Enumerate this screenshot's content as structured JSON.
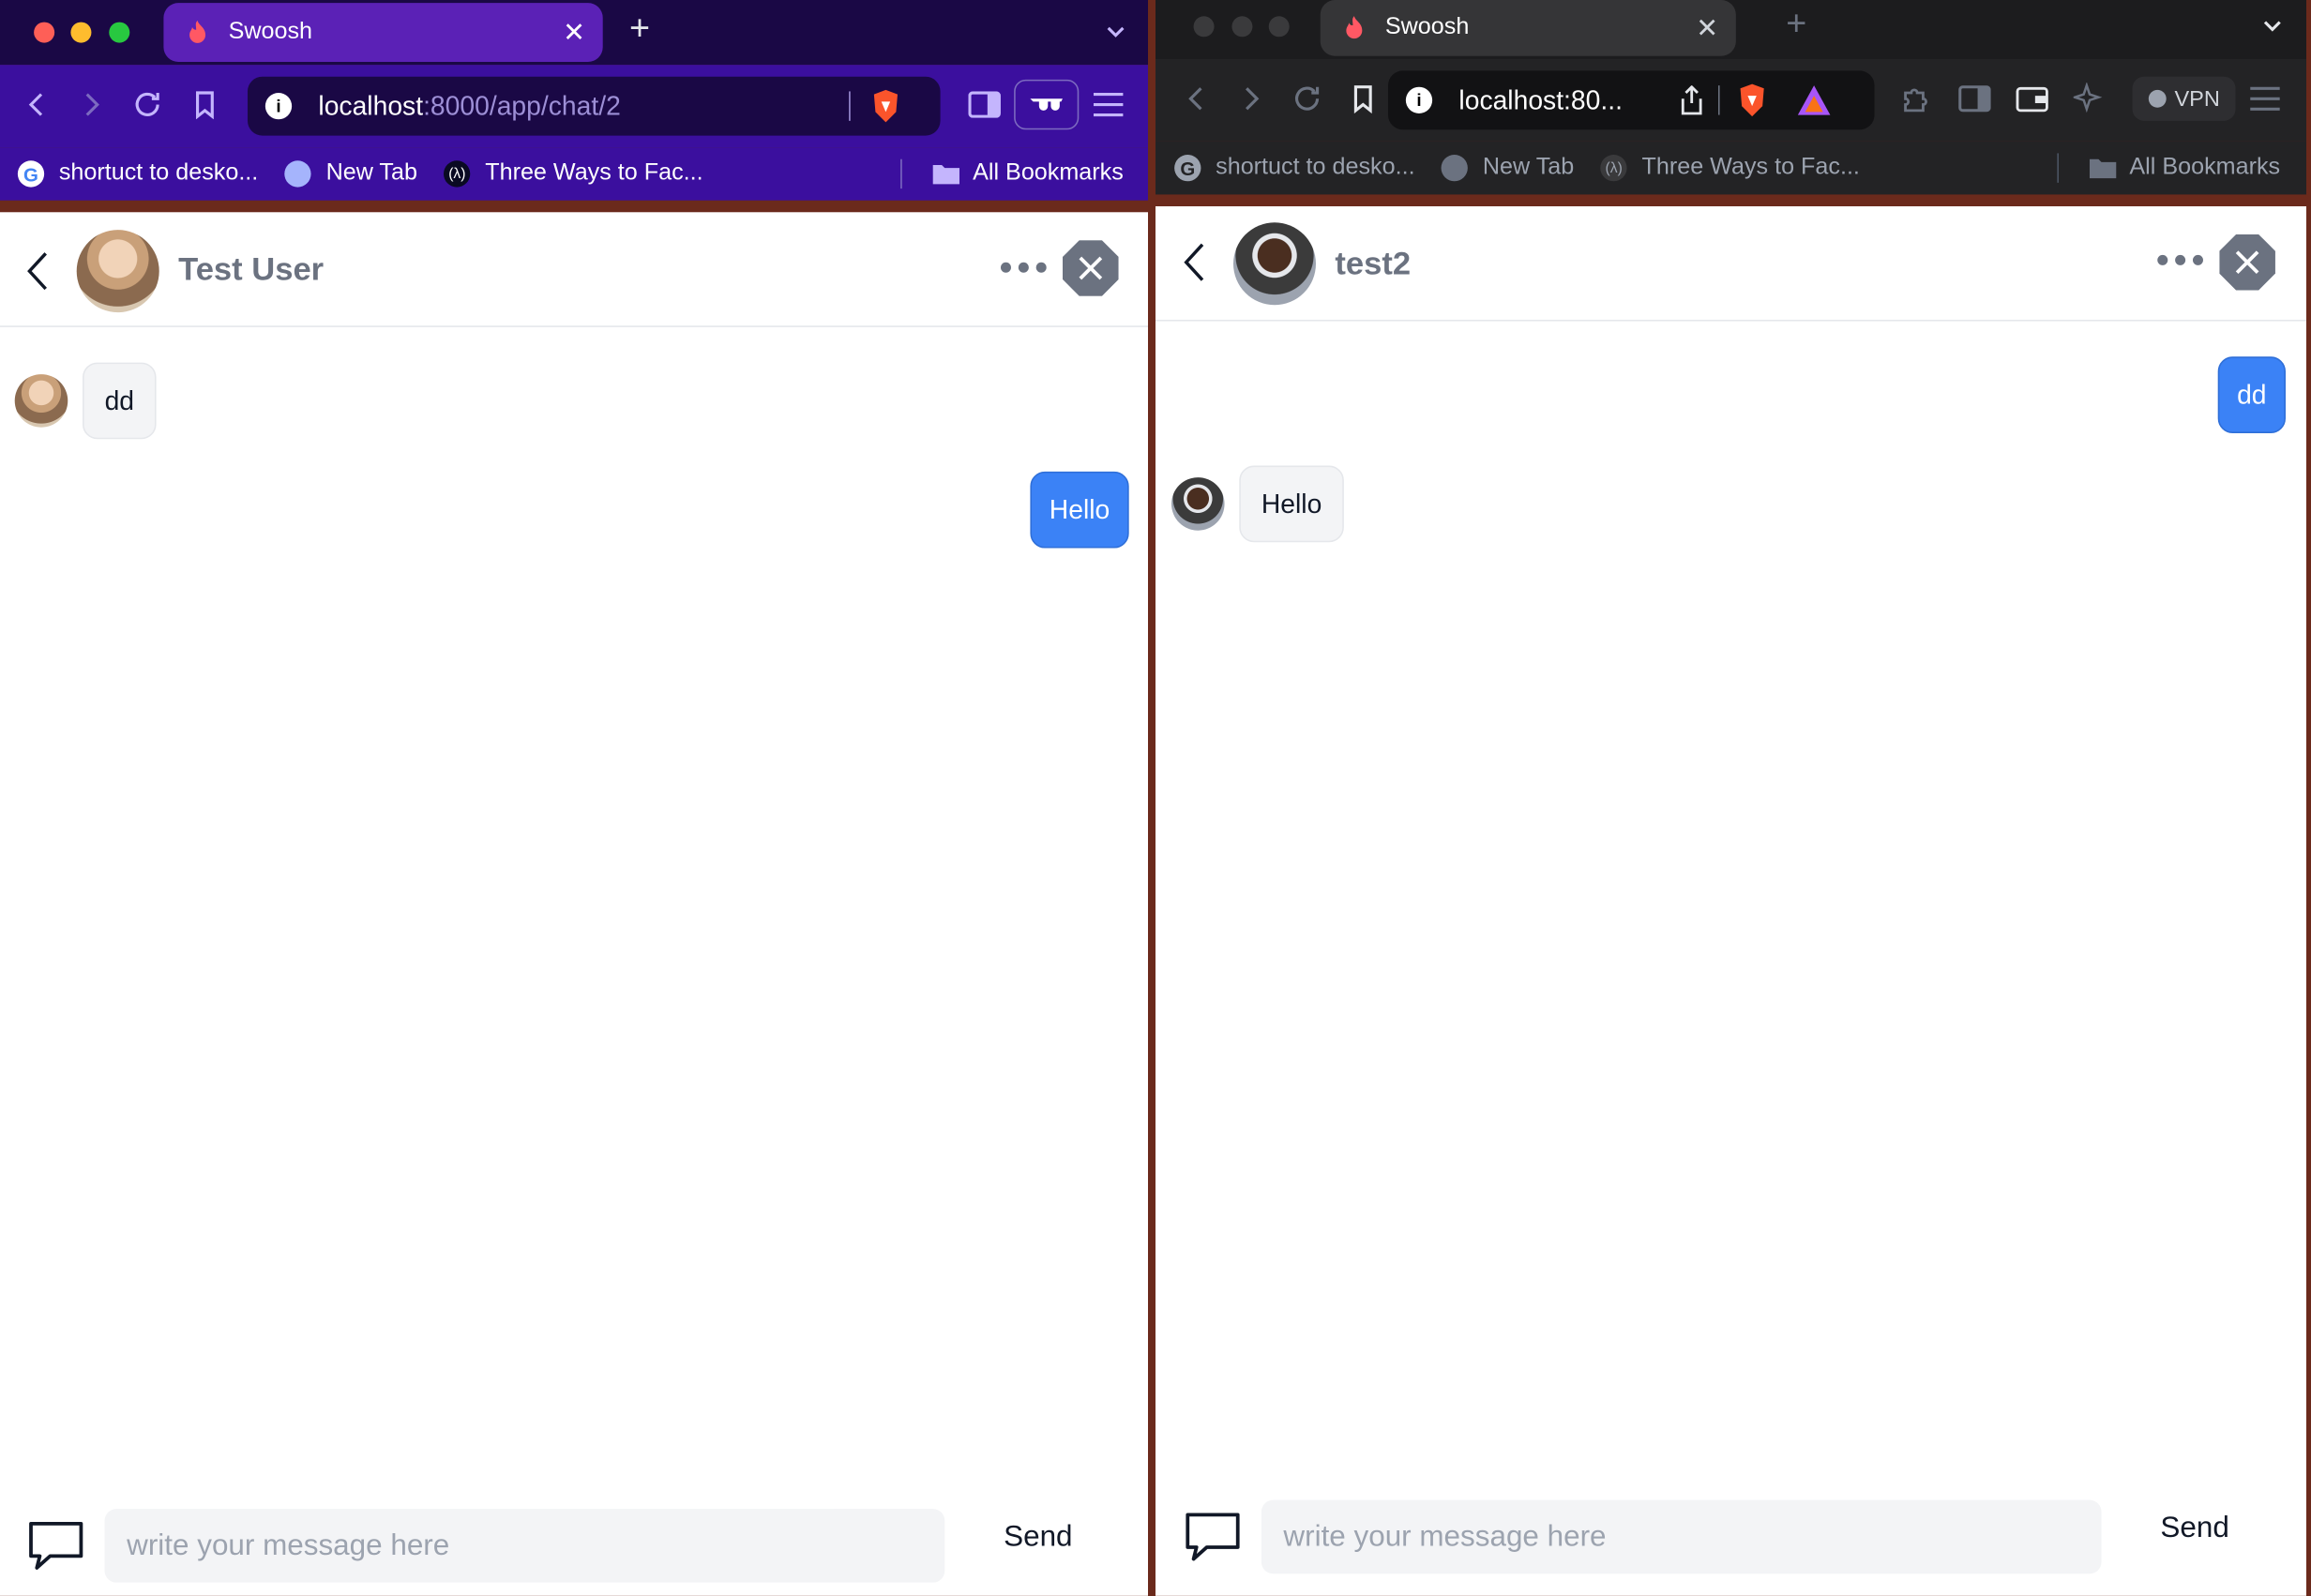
{
  "left_window": {
    "tab": {
      "title": "Swoosh"
    },
    "url": {
      "host": "localhost",
      "rest": ":8000/app/chat/2"
    },
    "bookmarks": [
      "shortuct to desko...",
      "New Tab",
      "Three Ways to Fac..."
    ],
    "all_bookmarks": "All Bookmarks",
    "chat": {
      "name": "Test User",
      "messages": [
        {
          "direction": "incoming",
          "text": "dd"
        },
        {
          "direction": "outgoing",
          "text": "Hello"
        }
      ],
      "input_placeholder": "write your message here",
      "send_label": "Send"
    }
  },
  "right_window": {
    "tab": {
      "title": "Swoosh"
    },
    "url": {
      "text": "localhost:80..."
    },
    "vpn_label": "VPN",
    "bookmarks": [
      "shortuct to desko...",
      "New Tab",
      "Three Ways to Fac..."
    ],
    "all_bookmarks": "All Bookmarks",
    "chat": {
      "name": "test2",
      "messages": [
        {
          "direction": "outgoing",
          "text": "dd"
        },
        {
          "direction": "incoming",
          "text": "Hello"
        }
      ],
      "input_placeholder": "write your message here",
      "send_label": "Send"
    }
  },
  "colors": {
    "left_chrome": "#2a0a6b",
    "left_tab_active": "#5b21b6",
    "right_chrome": "#232325",
    "outgoing_bubble": "#3b82f6",
    "incoming_bubble": "#f3f4f6",
    "header_text": "#6b7280"
  }
}
